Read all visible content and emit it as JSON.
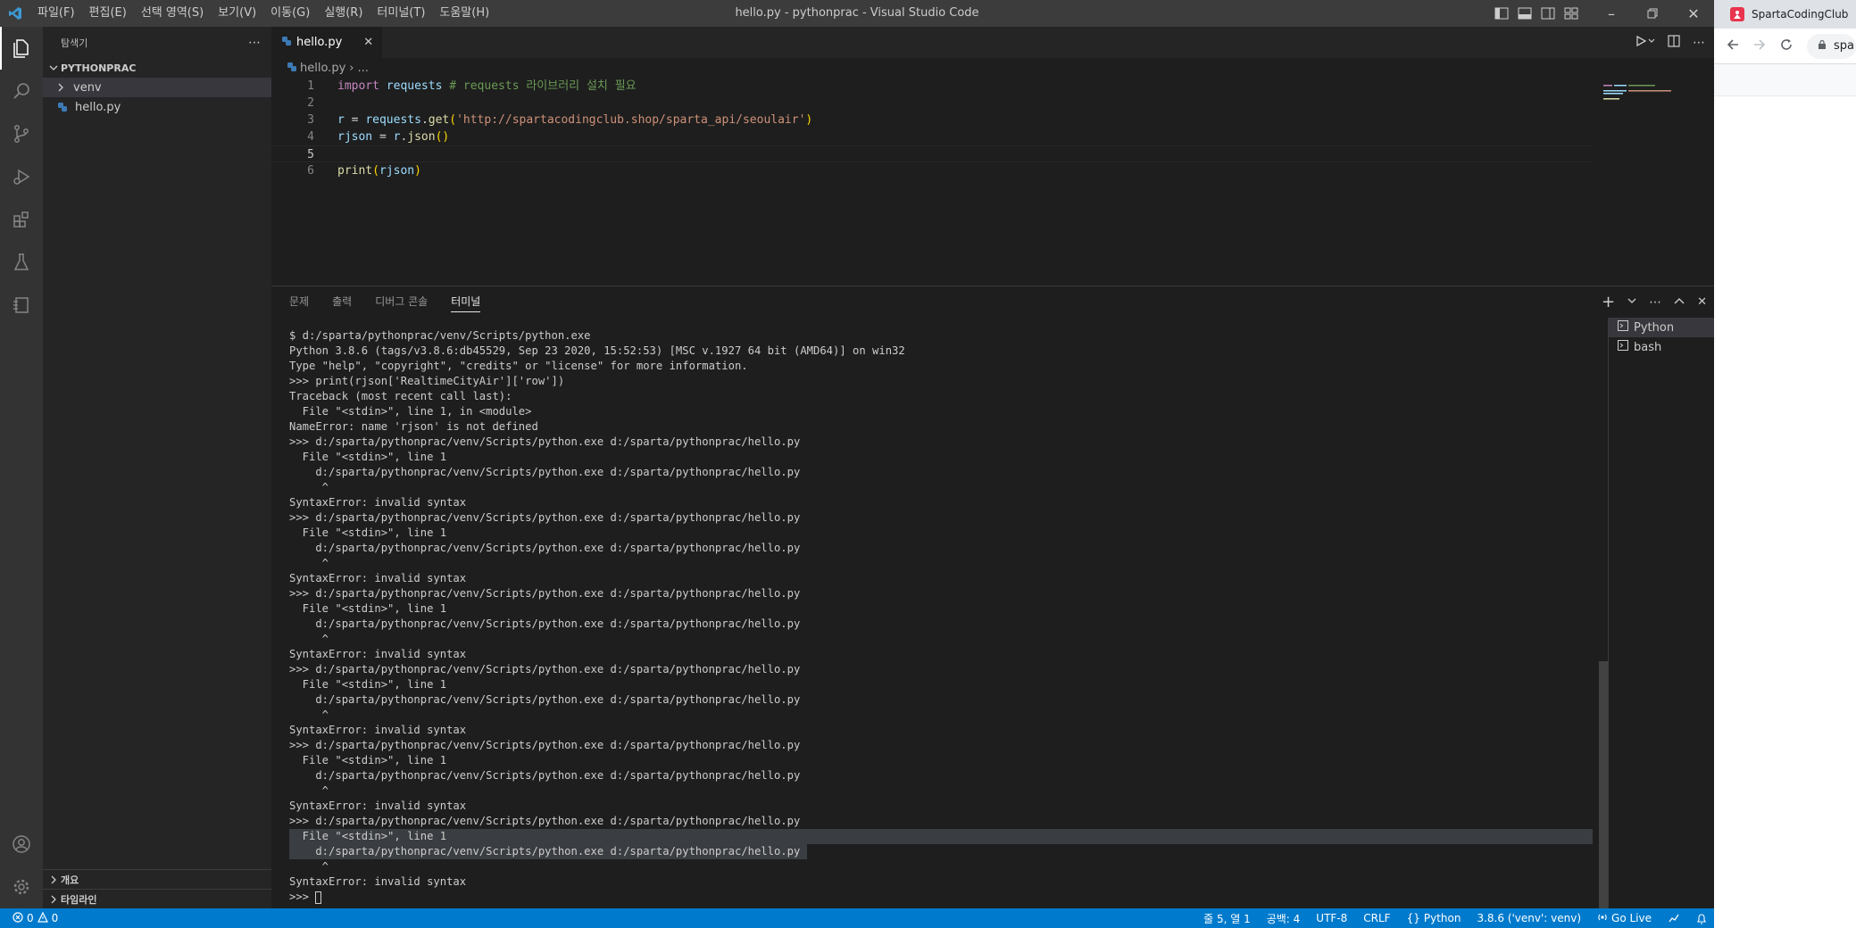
{
  "titlebar": {
    "menu": [
      "파일(F)",
      "편집(E)",
      "선택 영역(S)",
      "보기(V)",
      "이동(G)",
      "실행(R)",
      "터미널(T)",
      "도움말(H)"
    ],
    "title": "hello.py - pythonprac - Visual Studio Code"
  },
  "sidebar": {
    "title": "탐색기",
    "section": "PYTHONPRAC",
    "items": [
      {
        "label": "venv"
      },
      {
        "label": "hello.py"
      }
    ],
    "bottom": [
      "개요",
      "타임라인"
    ]
  },
  "editor": {
    "tab": "hello.py",
    "breadcrumb_file": "hello.py",
    "breadcrumb_more": "...",
    "code": [
      {
        "num": "1"
      },
      {
        "num": "2"
      },
      {
        "num": "3"
      },
      {
        "num": "4"
      },
      {
        "num": "5"
      },
      {
        "num": "6"
      }
    ],
    "l1": {
      "kw": "import",
      "mod": "requests",
      "cmt": "# requests 라이브러리 설치 필요"
    },
    "l3": {
      "r": "r",
      "eq": " = ",
      "mod": "requests",
      "dot": ".",
      "fn": "get",
      "p1": "(",
      "str": "'http://spartacodingclub.shop/sparta_api/seoulair'",
      "p2": ")"
    },
    "l4": {
      "v": "rjson",
      "eq": " = ",
      "r": "r",
      "dot": ".",
      "fn": "json",
      "pp": "()"
    },
    "l6": {
      "fn": "print",
      "p1": "(",
      "v": "rjson",
      "p2": ")"
    }
  },
  "panel": {
    "tabs": [
      "문제",
      "출력",
      "디버그 콘솔",
      "터미널"
    ],
    "active_tab": "터미널",
    "terminal_lines": [
      "$ d:/sparta/pythonprac/venv/Scripts/python.exe",
      "Python 3.8.6 (tags/v3.8.6:db45529, Sep 23 2020, 15:52:53) [MSC v.1927 64 bit (AMD64)] on win32",
      "Type \"help\", \"copyright\", \"credits\" or \"license\" for more information.",
      ">>> print(rjson['RealtimeCityAir']['row'])",
      "Traceback (most recent call last):",
      "  File \"<stdin>\", line 1, in <module>",
      "NameError: name 'rjson' is not defined",
      ">>> d:/sparta/pythonprac/venv/Scripts/python.exe d:/sparta/pythonprac/hello.py",
      "  File \"<stdin>\", line 1",
      "    d:/sparta/pythonprac/venv/Scripts/python.exe d:/sparta/pythonprac/hello.py",
      "     ^",
      "SyntaxError: invalid syntax",
      ">>> d:/sparta/pythonprac/venv/Scripts/python.exe d:/sparta/pythonprac/hello.py",
      "  File \"<stdin>\", line 1",
      "    d:/sparta/pythonprac/venv/Scripts/python.exe d:/sparta/pythonprac/hello.py",
      "     ^",
      "SyntaxError: invalid syntax",
      ">>> d:/sparta/pythonprac/venv/Scripts/python.exe d:/sparta/pythonprac/hello.py",
      "  File \"<stdin>\", line 1",
      "    d:/sparta/pythonprac/venv/Scripts/python.exe d:/sparta/pythonprac/hello.py",
      "     ^",
      "SyntaxError: invalid syntax",
      ">>> d:/sparta/pythonprac/venv/Scripts/python.exe d:/sparta/pythonprac/hello.py",
      "  File \"<stdin>\", line 1",
      "    d:/sparta/pythonprac/venv/Scripts/python.exe d:/sparta/pythonprac/hello.py",
      "     ^",
      "SyntaxError: invalid syntax",
      ">>> d:/sparta/pythonprac/venv/Scripts/python.exe d:/sparta/pythonprac/hello.py",
      "  File \"<stdin>\", line 1",
      "    d:/sparta/pythonprac/venv/Scripts/python.exe d:/sparta/pythonprac/hello.py",
      "     ^",
      "SyntaxError: invalid syntax",
      ">>> d:/sparta/pythonprac/venv/Scripts/python.exe d:/sparta/pythonprac/hello.py",
      "  File \"<stdin>\", line 1",
      "    d:/sparta/pythonprac/venv/Scripts/python.exe d:/sparta/pythonprac/hello.py",
      "     ^",
      "SyntaxError: invalid syntax",
      ">>> "
    ],
    "terminals": [
      "Python",
      "bash"
    ]
  },
  "statusbar": {
    "errors": "0",
    "warnings": "0",
    "position": "줄 5, 열 1",
    "spaces": "공백: 4",
    "encoding": "UTF-8",
    "eol": "CRLF",
    "language": "Python",
    "interpreter": "3.8.6 ('venv': venv)",
    "golive": "Go Live"
  },
  "browser": {
    "tab_title": "SpartaCodingClub",
    "url": "spa"
  },
  "colors": {
    "accent": "#007acc",
    "titlebar": "#3c3c3c",
    "activitybar": "#333333",
    "sidebar": "#252526",
    "editor": "#1e1e1e"
  }
}
